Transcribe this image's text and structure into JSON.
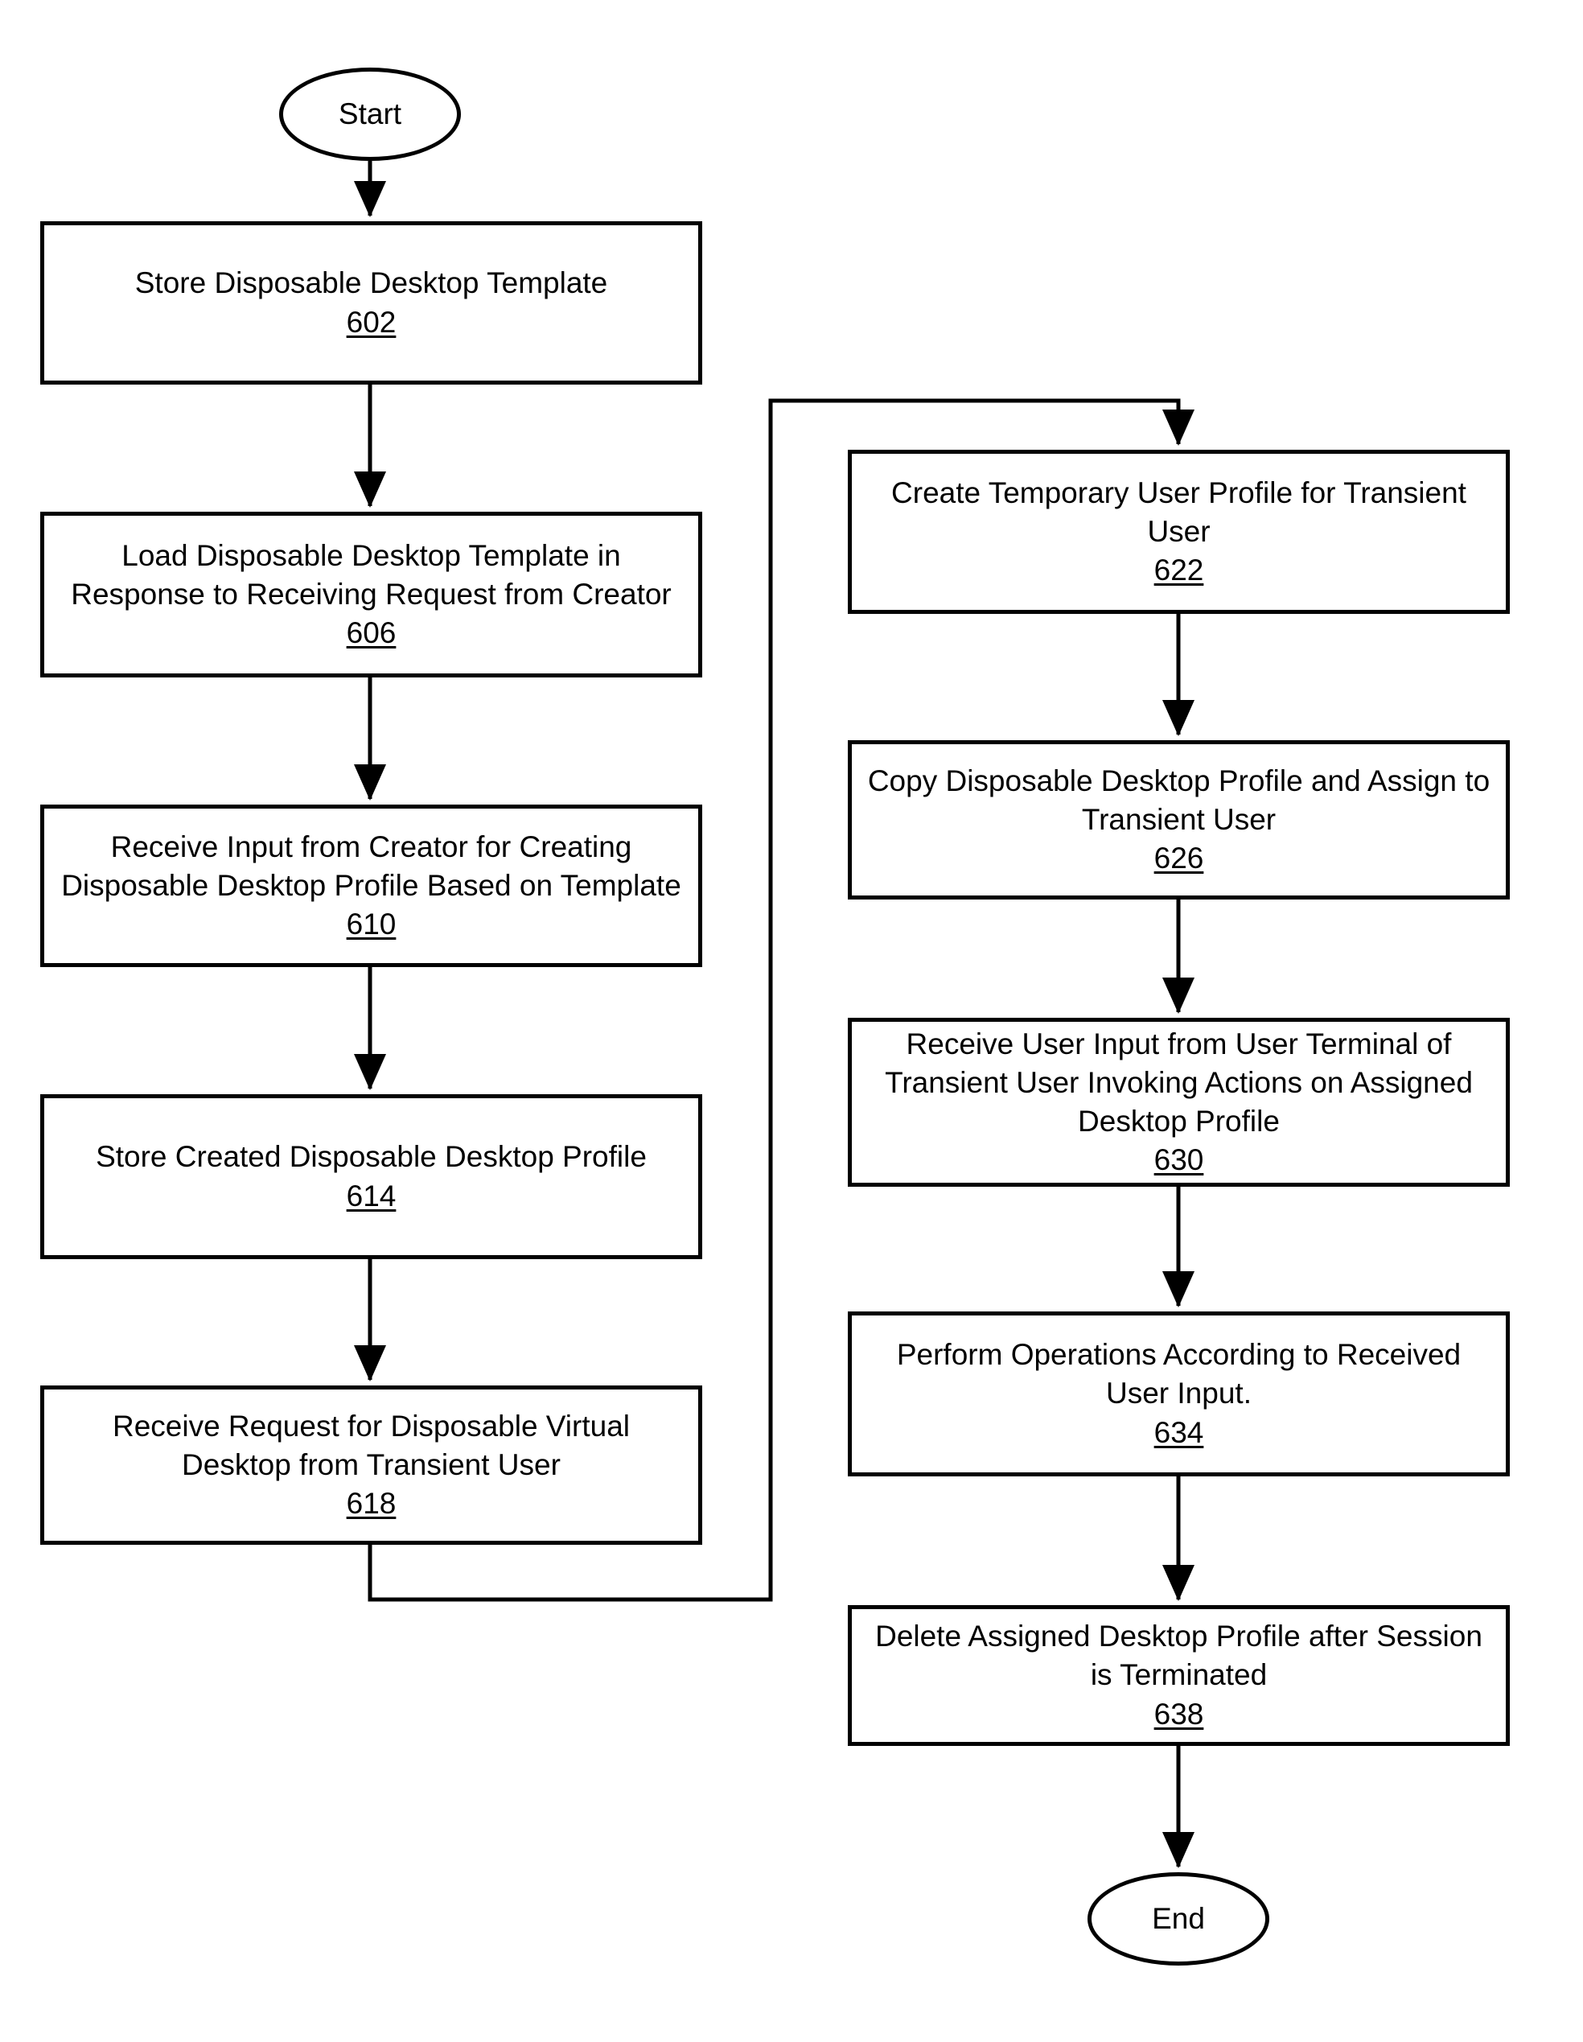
{
  "figure": {
    "type": "flowchart",
    "orientation": "two-column, top-to-bottom, left column then right column",
    "background_color": "#ffffff",
    "line_color": "#000000"
  },
  "terminators": {
    "start": {
      "label": "Start"
    },
    "end": {
      "label": "End"
    }
  },
  "nodes": [
    {
      "id": "n602",
      "label": "Store Disposable Desktop Template",
      "ref": "602",
      "column": "left"
    },
    {
      "id": "n606",
      "label": "Load Disposable Desktop Template in Response to Receiving Request from Creator",
      "ref": "606",
      "column": "left"
    },
    {
      "id": "n610",
      "label": "Receive Input from Creator for Creating Disposable Desktop Profile Based on Template",
      "ref": "610",
      "column": "left"
    },
    {
      "id": "n614",
      "label": "Store Created Disposable Desktop Profile",
      "ref": "614",
      "column": "left"
    },
    {
      "id": "n618",
      "label": "Receive Request for Disposable Virtual Desktop from Transient User",
      "ref": "618",
      "column": "left"
    },
    {
      "id": "n622",
      "label": "Create Temporary User Profile for Transient User",
      "ref": "622",
      "column": "right"
    },
    {
      "id": "n626",
      "label": "Copy Disposable Desktop Profile and Assign to Transient User",
      "ref": "626",
      "column": "right"
    },
    {
      "id": "n630",
      "label": "Receive User Input from User Terminal of Transient User Invoking Actions on Assigned Desktop Profile",
      "ref": "630",
      "column": "right"
    },
    {
      "id": "n634",
      "label": "Perform Operations According to Received User Input.",
      "ref": "634",
      "column": "right"
    },
    {
      "id": "n638",
      "label": "Delete Assigned Desktop Profile after Session is Terminated",
      "ref": "638",
      "column": "right"
    }
  ],
  "edges": [
    {
      "from": "start",
      "to": "n602",
      "style": "straight-down-arrow"
    },
    {
      "from": "n602",
      "to": "n606",
      "style": "straight-down-arrow"
    },
    {
      "from": "n606",
      "to": "n610",
      "style": "straight-down-arrow"
    },
    {
      "from": "n610",
      "to": "n614",
      "style": "straight-down-arrow"
    },
    {
      "from": "n614",
      "to": "n618",
      "style": "straight-down-arrow"
    },
    {
      "from": "n618",
      "to": "n622",
      "style": "routed-down-right-up-right-down-arrow"
    },
    {
      "from": "n622",
      "to": "n626",
      "style": "straight-down-arrow"
    },
    {
      "from": "n626",
      "to": "n630",
      "style": "straight-down-arrow"
    },
    {
      "from": "n630",
      "to": "n634",
      "style": "straight-down-arrow"
    },
    {
      "from": "n634",
      "to": "n638",
      "style": "straight-down-arrow"
    },
    {
      "from": "n638",
      "to": "end",
      "style": "straight-down-arrow"
    }
  ]
}
